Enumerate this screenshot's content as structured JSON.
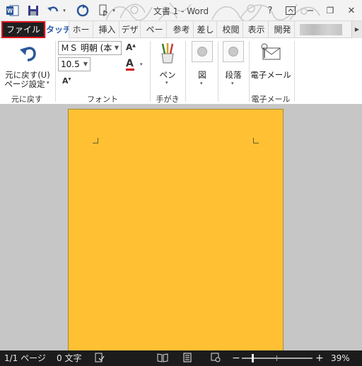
{
  "titlebar": {
    "title": "文書 1 - Word",
    "help_label": "?",
    "minimize_label": "−",
    "restore_label": "❐",
    "close_label": "✕"
  },
  "tabs": [
    {
      "label": "ファイル"
    },
    {
      "label": "タッチ"
    },
    {
      "label": "ホー"
    },
    {
      "label": "挿入"
    },
    {
      "label": "デザ"
    },
    {
      "label": "ペー"
    },
    {
      "label": "参考"
    },
    {
      "label": "差し"
    },
    {
      "label": "校閲"
    },
    {
      "label": "表示"
    },
    {
      "label": "開発"
    }
  ],
  "ribbon": {
    "undo": {
      "line1": "元に戻す(U)",
      "line2": "ページ設定"
    },
    "groups": {
      "undo": "元に戻す",
      "font": "フォント",
      "handwriting": "手がき",
      "email": "電子メール"
    },
    "font_name": "ＭＳ 明朝 (本",
    "font_size": "10.5",
    "pen_label": "ペン",
    "figure_label": "図",
    "paragraph_label": "段落",
    "email_label": "電子メール"
  },
  "statusbar": {
    "page": "1/1 ページ",
    "words": "0 文字",
    "zoom": "39%"
  },
  "colors": {
    "page_fill": "#ffc133",
    "file_tab_bg": "#1f1f1f",
    "highlight_border": "#e0101a",
    "accent": "#2f5ea8"
  }
}
